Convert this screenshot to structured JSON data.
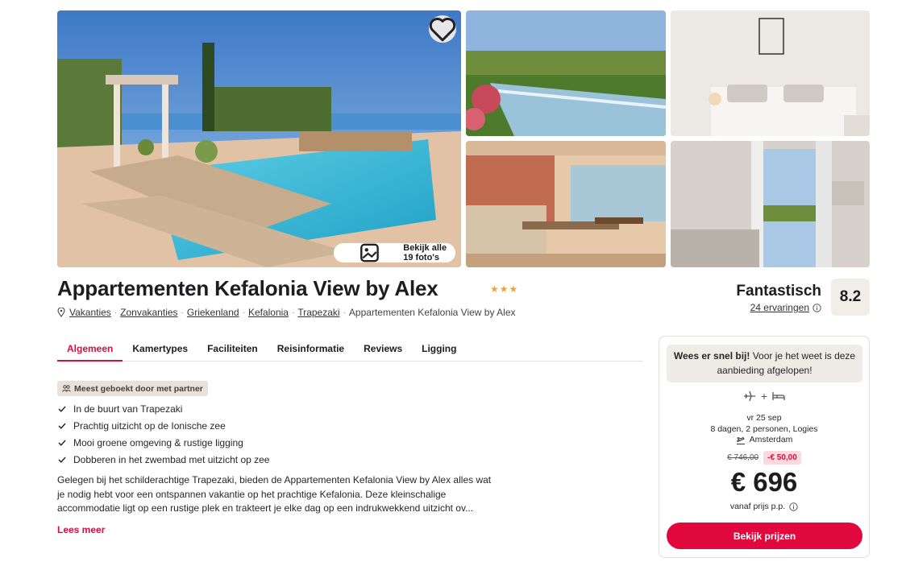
{
  "gallery": {
    "view_all_label": "Bekijk alle 19 foto's"
  },
  "hotel": {
    "name": "Appartementen Kefalonia View by Alex",
    "stars": 3
  },
  "breadcrumb": {
    "items": [
      "Vakanties",
      "Zonvakanties",
      "Griekenland",
      "Kefalonia",
      "Trapezaki"
    ],
    "current": "Appartementen Kefalonia View by Alex"
  },
  "rating": {
    "label": "Fantastisch",
    "reviews": "24 ervaringen",
    "score": "8.2"
  },
  "tabs": [
    "Algemeen",
    "Kamertypes",
    "Faciliteiten",
    "Reisinformatie",
    "Reviews",
    "Ligging"
  ],
  "badge": "Meest geboekt door met partner",
  "usps": [
    "In de buurt van Trapezaki",
    "Prachtig uitzicht op de Ionische zee",
    "Mooi groene omgeving & rustige ligging",
    "Dobberen in het zwembad met uitzicht op zee"
  ],
  "description": "Gelegen bij het schilderachtige Trapezaki, bieden de Appartementen Kefalonia View by Alex alles wat je nodig hebt voor een ontspannen vakantie op het prachtige Kefalonia. Deze kleinschalige accommodatie ligt op een rustige plek en trakteert je elke dag op een indrukwekkend uitzicht ov...",
  "read_more": "Lees meer",
  "card": {
    "alert_bold": "Wees er snel bij!",
    "alert_text": " Voor je het weet is deze aanbieding afgelopen!",
    "date": "vr 25 sep",
    "details": "8 dagen, 2 personen, Logies",
    "departure": "Amsterdam",
    "old_price": "€ 746,00",
    "discount": "-€ 50,00",
    "price": "€ 696",
    "price_note": "vanaf prijs p.p.",
    "cta": "Bekijk prijzen"
  },
  "colors": {
    "accent": "#e1083d",
    "star": "#f0a23a",
    "score_bg": "#f1ede8"
  },
  "icons": [
    "heart-icon",
    "gallery-icon",
    "location-pin-icon",
    "info-icon",
    "partner-icon",
    "check-icon",
    "flight-icon",
    "bed-icon",
    "departure-icon"
  ]
}
